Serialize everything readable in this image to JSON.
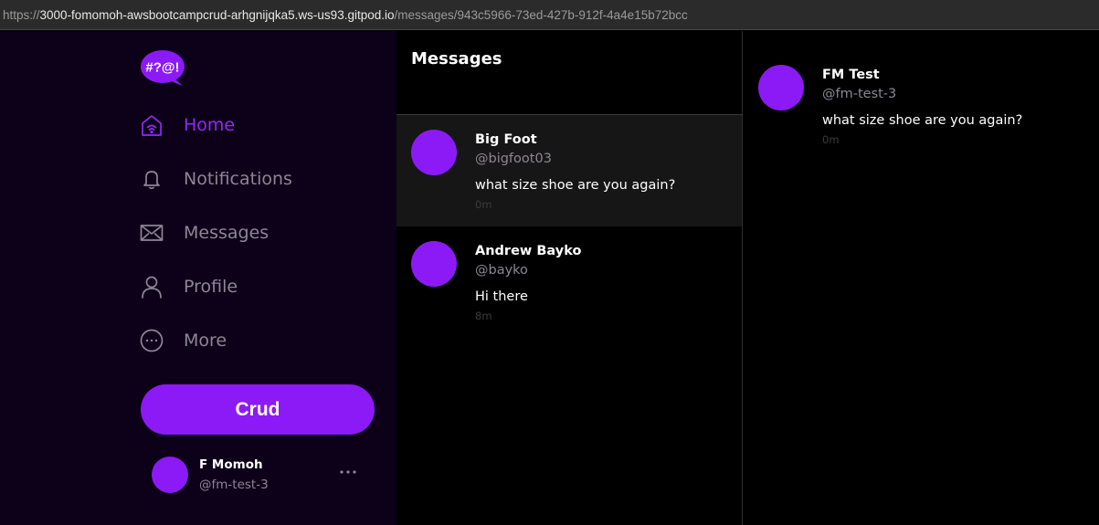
{
  "browser": {
    "url_scheme": "https://",
    "url_host": "3000-fomomoh-awsbootcampcrud-arhgnijqka5.ws-us93.gitpod.io",
    "url_path": "/messages/943c5966-73ed-427b-912f-4a4e15b72bcc"
  },
  "sidebar": {
    "logo_text": "#?@!",
    "nav": [
      {
        "label": "Home",
        "icon": "home-icon",
        "active": true
      },
      {
        "label": "Notifications",
        "icon": "bell-icon",
        "active": false
      },
      {
        "label": "Messages",
        "icon": "envelope-icon",
        "active": false
      },
      {
        "label": "Profile",
        "icon": "user-icon",
        "active": false
      },
      {
        "label": "More",
        "icon": "more-circle-icon",
        "active": false
      }
    ],
    "crud_label": "Crud",
    "profile": {
      "name": "F Momoh",
      "handle": "@fm-test-3"
    }
  },
  "feed": {
    "title": "Messages",
    "groups": [
      {
        "name": "Big Foot",
        "handle": "@bigfoot03",
        "message": "what size shoe are you again?",
        "time": "0m",
        "selected": true
      },
      {
        "name": "Andrew Bayko",
        "handle": "@bayko",
        "message": "Hi there",
        "time": "8m",
        "selected": false
      }
    ]
  },
  "conversation": {
    "messages": [
      {
        "name": "FM Test",
        "handle": "@fm-test-3",
        "message": "what size shoe are you again?",
        "time": "0m"
      }
    ]
  },
  "colors": {
    "accent": "#8c1af6",
    "sidebar_bg": "#0d0019",
    "muted_text": "#8d8694"
  }
}
